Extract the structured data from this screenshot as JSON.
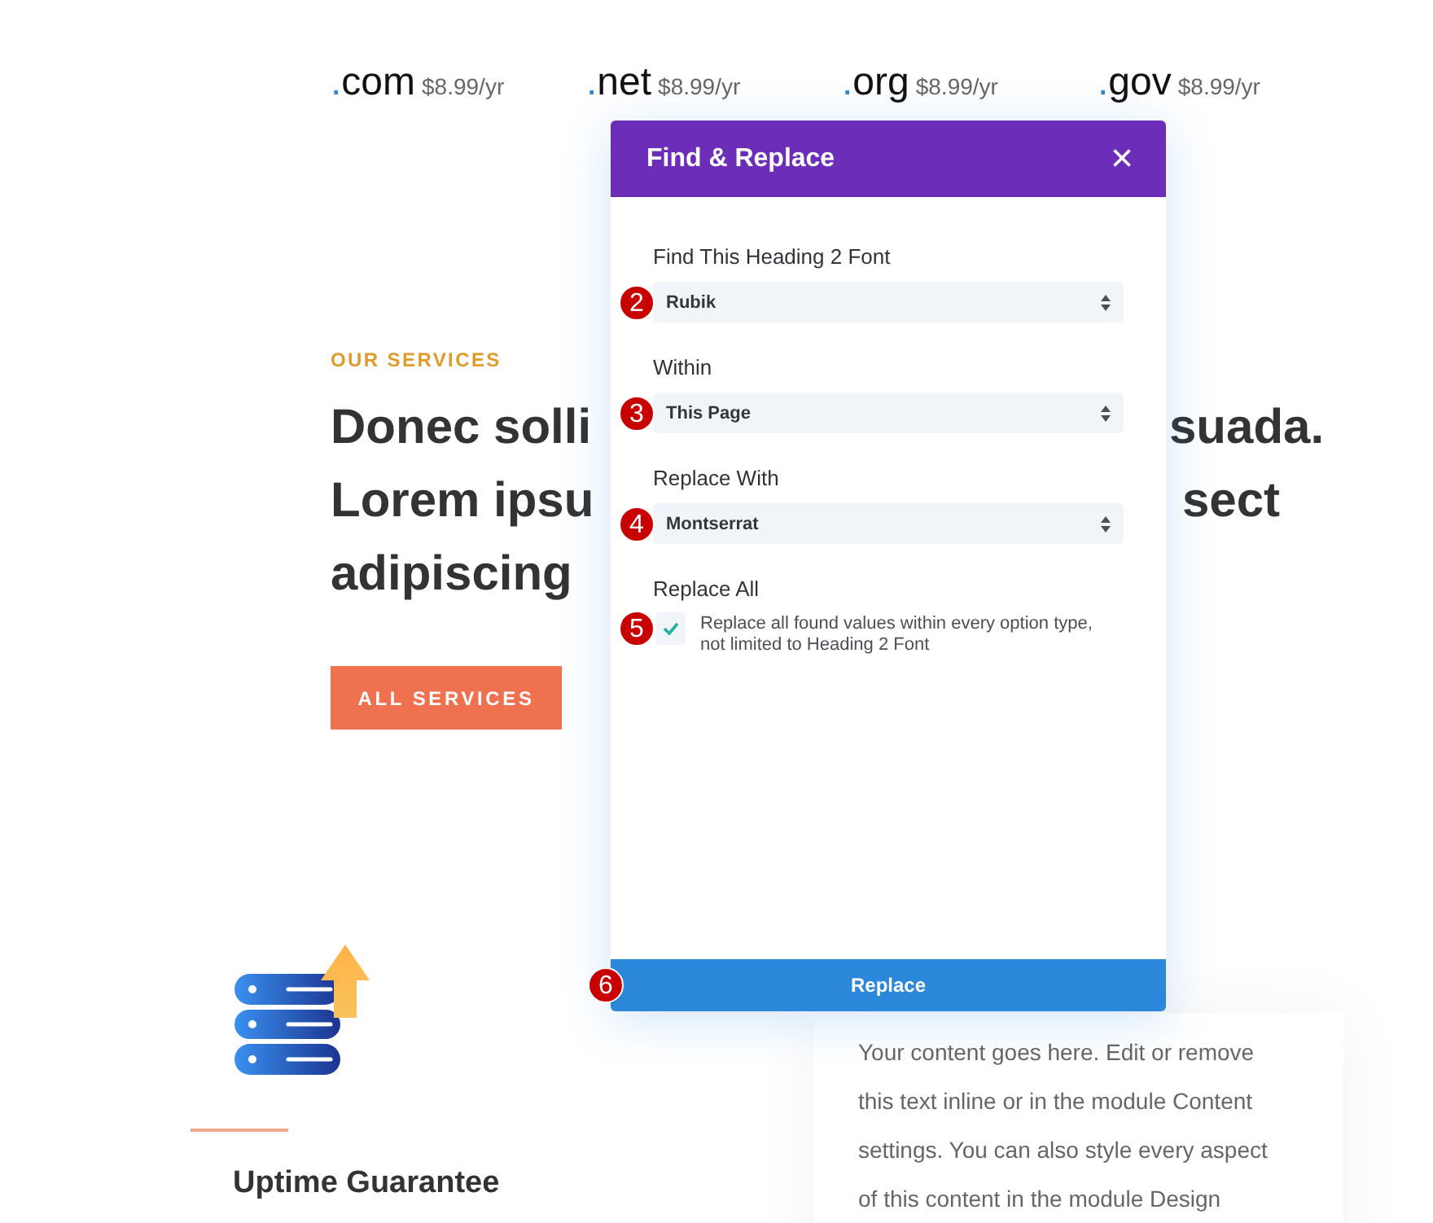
{
  "domains": [
    {
      "dot": ".",
      "tld": "com",
      "price": "$8.99/yr"
    },
    {
      "dot": ".",
      "tld": "net",
      "price": "$8.99/yr"
    },
    {
      "dot": ".",
      "tld": "org",
      "price": "$8.99/yr"
    },
    {
      "dot": ".",
      "tld": "gov",
      "price": "$8.99/yr"
    }
  ],
  "services": {
    "eyebrow": "OUR SERVICES",
    "heading_lines": [
      {
        "left": "Donec solli",
        "right": "suada."
      },
      {
        "left": "Lorem ipsu",
        "right": "sect"
      },
      {
        "left": "adipiscing"
      }
    ],
    "button": "ALL SERVICES"
  },
  "dialog": {
    "title": "Find & Replace",
    "close": "×",
    "fields": [
      {
        "label": "Find This Heading 2 Font",
        "value": "Rubik",
        "marker": "2"
      },
      {
        "label": "Within",
        "value": "This Page",
        "marker": "3"
      },
      {
        "label": "Replace With",
        "value": "Montserrat",
        "marker": "4"
      }
    ],
    "replace_all": {
      "label": "Replace All",
      "checked": true,
      "description": "Replace all found values within every option type, not limited to Heading 2 Font",
      "marker": "5"
    },
    "button": {
      "label": "Replace",
      "marker": "6"
    }
  },
  "feature": {
    "title": "Uptime Guarantee"
  },
  "content_card": {
    "lines": [
      "Your content goes here. Edit or remove",
      "this text inline or in the module Content",
      "settings. You can also style every aspect",
      "of this content in the module Design"
    ]
  }
}
